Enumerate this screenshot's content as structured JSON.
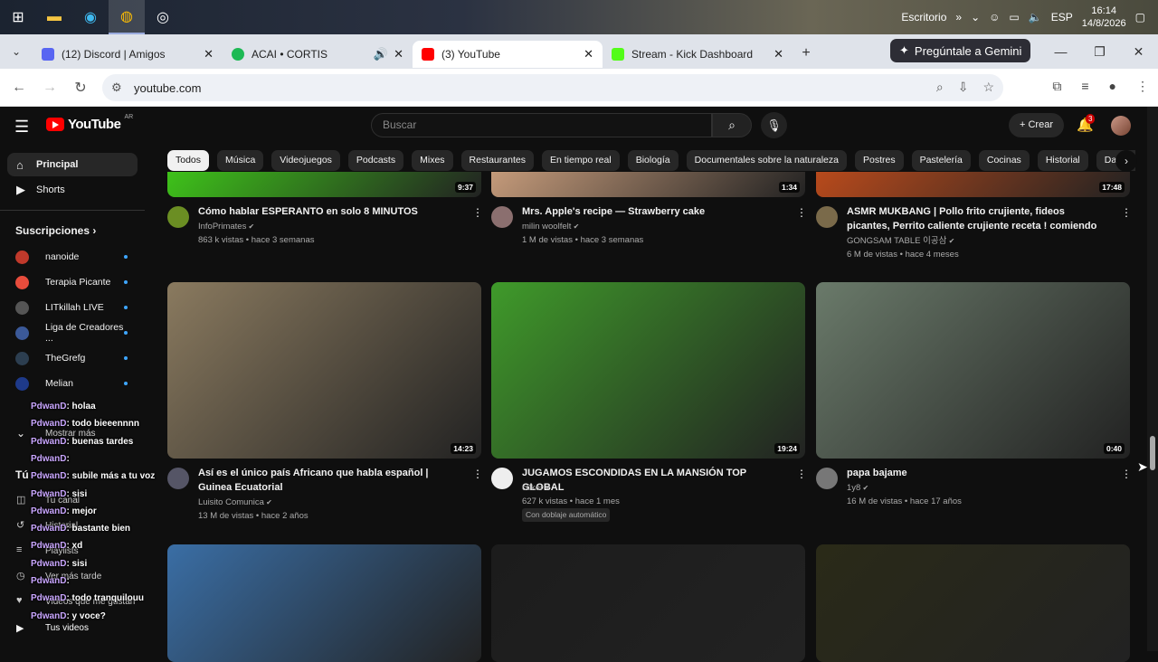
{
  "taskbar": {
    "tray_label": "Escritorio",
    "lang": "ESP",
    "time": "16:14",
    "date": "14/8/2026"
  },
  "tabs": [
    {
      "label": "(12) Discord | Amigos",
      "color": "#5865f2"
    },
    {
      "label": "ACAI • CORTIS",
      "color": "#1db954"
    },
    {
      "label": "(3) YouTube",
      "color": "#ff0000"
    },
    {
      "label": "Stream - Kick Dashboard",
      "color": "#53fc18"
    }
  ],
  "gemini_label": "Pregúntale a Gemini",
  "url": "youtube.com",
  "youtube": {
    "logo": "YouTube",
    "region": "AR",
    "search_placeholder": "Buscar",
    "create_label": "Crear",
    "notif_count": "3"
  },
  "chips": [
    "Todos",
    "Música",
    "Videojuegos",
    "Podcasts",
    "Mixes",
    "Restaurantes",
    "En tiempo real",
    "Biología",
    "Documentales sobre la naturaleza",
    "Postres",
    "Pastelería",
    "Cocinas",
    "Historial",
    "Dance pop"
  ],
  "sidebar": {
    "principal": "Principal",
    "shorts": "Shorts",
    "subs_header": "Suscripciones",
    "subs": [
      {
        "name": "nanoide",
        "color": "#c0392b"
      },
      {
        "name": "Terapia Picante",
        "color": "#e74c3c"
      },
      {
        "name": "LITkillah LIVE",
        "color": "#555"
      },
      {
        "name": "Liga de Creadores ...",
        "color": "#3b5998"
      },
      {
        "name": "TheGrefg",
        "color": "#2c3e50"
      },
      {
        "name": "Melian",
        "color": "#1e3a8a"
      }
    ],
    "mostrar_mas": "Mostrar más",
    "tu_section": "Tú",
    "tu_canal": "Tu canal",
    "historial": "Historial",
    "playlists": "Playlists",
    "ver_mas_tarde": "Ver más tarde",
    "videos_gusta": "Videos que me gustan",
    "tus_videos": "Tus videos"
  },
  "chat": [
    {
      "user": "PdwanD",
      "msg": ": holaa"
    },
    {
      "user": "PdwanD",
      "msg": ": todo bieeennnn"
    },
    {
      "user": "PdwanD",
      "msg": ": buenas tardes"
    },
    {
      "user": "PdwanD",
      "msg": ":"
    },
    {
      "user": "PdwanD",
      "msg": ": subile más a tu voz"
    },
    {
      "user": "PdwanD",
      "msg": ": sisi"
    },
    {
      "user": "PdwanD",
      "msg": ": mejor"
    },
    {
      "user": "PdwanD",
      "msg": ": bastante bien"
    },
    {
      "user": "PdwanD",
      "msg": ": xd"
    },
    {
      "user": "PdwanD",
      "msg": ": sisi"
    },
    {
      "user": "PdwanD",
      "msg": ":"
    },
    {
      "user": "PdwanD",
      "msg": ": todo tranquilouu"
    },
    {
      "user": "PdwanD",
      "msg": ": y voce?"
    }
  ],
  "videos": [
    {
      "title": "Cómo hablar ESPERANTO en solo 8 MINUTOS",
      "channel": "InfoPrimates",
      "views": "863 k vistas • hace 3 semanas",
      "duration": "9:37",
      "thumb": "#3ec21a",
      "avatar": "#6b8e23"
    },
    {
      "title": "Mrs. Apple's recipe — Strawberry cake",
      "channel": "milin woolfelt",
      "views": "1 M de vistas • hace 3 semanas",
      "duration": "1:34",
      "thumb": "#c49a7a",
      "avatar": "#8b6f6f"
    },
    {
      "title": "ASMR MUKBANG | Pollo frito crujiente, fideos picantes, Perrito caliente crujiente receta ! comiendo",
      "channel": "GONGSAM TABLE 이공삼",
      "views": "6 M de vistas • hace 4 meses",
      "duration": "17:48",
      "thumb": "#b84a1c",
      "avatar": "#7a6a4a"
    },
    {
      "title": "Así es el único país Africano que habla español | Guinea Ecuatorial",
      "channel": "Luisito Comunica",
      "views": "13 M de vistas • hace 2 años",
      "duration": "14:23",
      "thumb": "#8a7a5f",
      "avatar": "#556"
    },
    {
      "title": "JUGAMOS ESCONDIDAS EN LA MANSIÓN TOP GLOBAL",
      "channel": "c0ker",
      "views": "627 k vistas • hace 1 mes",
      "extra": "Con doblaje automático",
      "duration": "19:24",
      "thumb": "#3f9a2a",
      "avatar": "#eee"
    },
    {
      "title": "papa bajame",
      "channel": "1y8",
      "views": "16 M de vistas • hace 17 años",
      "duration": "0:40",
      "thumb": "#6a7a6a",
      "avatar": "#777"
    },
    {
      "thumb": "#3a6ea5"
    },
    {
      "thumb": "#1c1c1c"
    },
    {
      "thumb": "#2a2a18"
    }
  ]
}
